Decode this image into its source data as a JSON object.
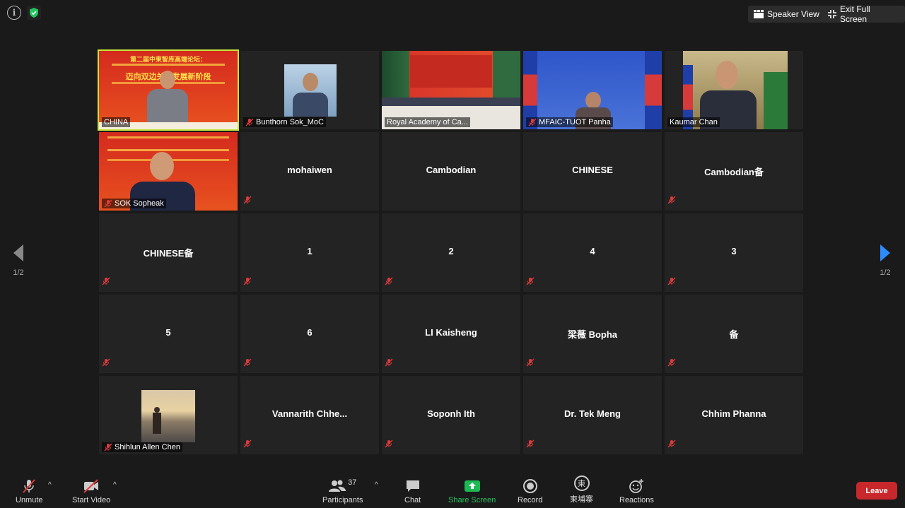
{
  "top": {
    "speaker_view": "Speaker View",
    "exit_full_screen": "Exit Full Screen"
  },
  "page_indicator": {
    "left": "1/2",
    "right": "1/2"
  },
  "tiles": [
    {
      "name": "CHINA",
      "video": true,
      "active": true
    },
    {
      "name": "Bunthorn Sok_MoC",
      "video": true,
      "muted": true
    },
    {
      "name": "Royal Academy of Ca...",
      "video": true
    },
    {
      "name": "MFAIC-TUOT Panha",
      "video": true,
      "muted": true
    },
    {
      "name": "Kaumar Chan",
      "video": true
    },
    {
      "name": "SOK Sopheak",
      "video": true,
      "muted": true
    },
    {
      "name": "mohaiwen",
      "muted": true
    },
    {
      "name": "Cambodian"
    },
    {
      "name": "CHINESE"
    },
    {
      "name": "Cambodian备",
      "muted": true
    },
    {
      "name": "CHINESE备",
      "muted": true
    },
    {
      "name": "1",
      "muted": true
    },
    {
      "name": "2",
      "muted": true
    },
    {
      "name": "4",
      "muted": true
    },
    {
      "name": "3",
      "muted": true
    },
    {
      "name": "5",
      "muted": true
    },
    {
      "name": "6",
      "muted": true
    },
    {
      "name": "LI Kaisheng",
      "muted": true
    },
    {
      "name": "梁薇 Bopha",
      "muted": true
    },
    {
      "name": "备",
      "muted": true
    },
    {
      "name": "Shihlun Allen Chen",
      "video": true,
      "muted": true
    },
    {
      "name": "Vannarith Chhe...",
      "muted": true
    },
    {
      "name": "Soponh Ith",
      "muted": true
    },
    {
      "name": "Dr. Tek Meng",
      "muted": true
    },
    {
      "name": "Chhim Phanna",
      "muted": true
    }
  ],
  "banner": {
    "title_cn": "第二届中柬智库高端论坛：",
    "subtitle_cn": "迈向双边关系发展新阶段"
  },
  "toolbar": {
    "unmute": "Unmute",
    "start_video": "Start Video",
    "participants": "Participants",
    "participant_count": "37",
    "chat": "Chat",
    "share_screen": "Share Screen",
    "record": "Record",
    "avatar_char": "柬",
    "user": "柬埔寨",
    "reactions": "Reactions",
    "leave": "Leave"
  },
  "colors": {
    "accent_green": "#1db954",
    "leave_red": "#c8282b",
    "active_border": "#c6e63b",
    "arrow_blue": "#2d8cff"
  }
}
